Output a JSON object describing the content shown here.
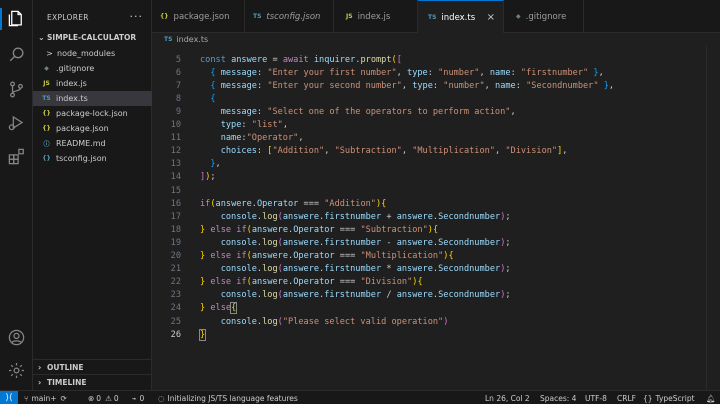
{
  "sidebar": {
    "title": "EXPLORER",
    "more": "···",
    "project": "SIMPLE-CALCULATOR",
    "files": [
      {
        "name": "node_modules",
        "kind": "folder",
        "icon": ">",
        "color": "#cccccc"
      },
      {
        "name": ".gitignore",
        "kind": "git",
        "icon": "◆",
        "color": "#6d8086"
      },
      {
        "name": "index.js",
        "kind": "js",
        "icon": "JS",
        "color": "#cbcb41"
      },
      {
        "name": "index.ts",
        "kind": "ts",
        "icon": "TS",
        "color": "#519aba"
      },
      {
        "name": "package-lock.json",
        "kind": "json",
        "icon": "{}",
        "color": "#cbcb41"
      },
      {
        "name": "package.json",
        "kind": "json",
        "icon": "{}",
        "color": "#cbcb41"
      },
      {
        "name": "README.md",
        "kind": "md",
        "icon": "ⓘ",
        "color": "#519aba"
      },
      {
        "name": "tsconfig.json",
        "kind": "json",
        "icon": "{}",
        "color": "#519aba"
      }
    ],
    "outline": "OUTLINE",
    "timeline": "TIMELINE"
  },
  "tabs": [
    {
      "label": "package.json",
      "icon": "{}",
      "color": "#cbcb41"
    },
    {
      "label": "tsconfig.json",
      "icon": "TS",
      "color": "#519aba"
    },
    {
      "label": "index.js",
      "icon": "JS",
      "color": "#cbcb41"
    },
    {
      "label": "index.ts",
      "icon": "TS",
      "color": "#519aba",
      "close": "×"
    },
    {
      "label": ".gitignore",
      "icon": "◆",
      "color": "#6d8086"
    }
  ],
  "breadcrumb": {
    "icon": "TS",
    "file": "index.ts"
  },
  "code": {
    "line_numbers": [
      "5",
      "6",
      "7",
      "8",
      "9",
      "10",
      "11",
      "12",
      "13",
      "14",
      "15",
      "16",
      "17",
      "18",
      "19",
      "20",
      "21",
      "22",
      "23",
      "24",
      "25",
      "26"
    ],
    "current_line": "26"
  },
  "status": {
    "branch": "main+",
    "errors": "0",
    "warnings": "0",
    "ports": "0",
    "task": "Initializing JS/TS language features",
    "position": "Ln 26, Col 2",
    "spaces": "Spaces: 4",
    "encoding": "UTF-8",
    "eol": "CRLF",
    "language": "TypeScript"
  },
  "colors": {
    "accent": "#0078d4",
    "editor_bg": "#1f1f1f",
    "sidebar_bg": "#181818"
  }
}
